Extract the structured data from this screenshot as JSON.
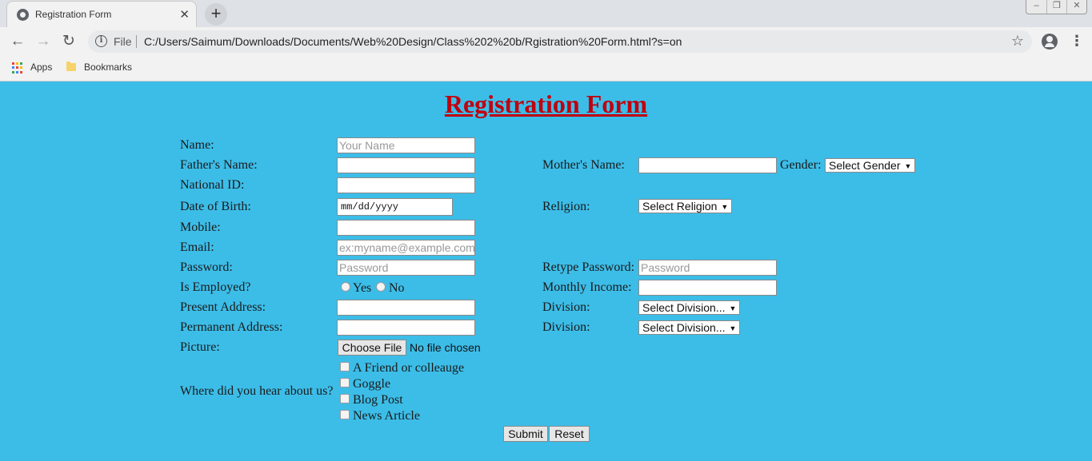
{
  "browser": {
    "tab_title": "Registration Form",
    "close_glyph": "✕",
    "new_tab_glyph": "+",
    "scheme": "File",
    "url": "C:/Users/Saimum/Downloads/Documents/Web%20Design/Class%202%20b/Rgistration%20Form.html?s=on",
    "bookmarks": [
      "Apps",
      "Bookmarks"
    ]
  },
  "page": {
    "heading": "Registration Form",
    "labels": {
      "name": "Name:",
      "father": "Father's Name:",
      "national_id": "National ID:",
      "dob": "Date of Birth:",
      "mobile": "Mobile:",
      "email": "Email:",
      "password": "Password:",
      "employed": "Is Employed?",
      "present_address": "Present Address:",
      "permanent_address": "Permanent Address:",
      "picture": "Picture:",
      "hear_about": "Where did you hear about us?",
      "mother": "Mother's Name:",
      "gender": "Gender:",
      "religion": "Religion:",
      "retype_password": "Retype Password:",
      "monthly_income": "Monthly Income:",
      "division_1": "Division:",
      "division_2": "Division:"
    },
    "placeholders": {
      "name": "Your Name",
      "email": "ex:myname@example.com",
      "password": "Password",
      "retype_password": "Password"
    },
    "dob_placeholder": "mm/dd/yyyy",
    "selects": {
      "gender": "Select Gender",
      "religion": "Select Religion",
      "division_1": "Select Division...",
      "division_2": "Select Division..."
    },
    "employed_options": [
      "Yes",
      "No"
    ],
    "file": {
      "button": "Choose File",
      "status": "No file chosen"
    },
    "hear_options": [
      "A Friend or colleauge",
      "Goggle",
      "Blog Post",
      "News Article"
    ],
    "buttons": {
      "submit": "Submit",
      "reset": "Reset"
    }
  },
  "colors": {
    "page_background": "#3cbde8",
    "heading": "#c0000e"
  }
}
